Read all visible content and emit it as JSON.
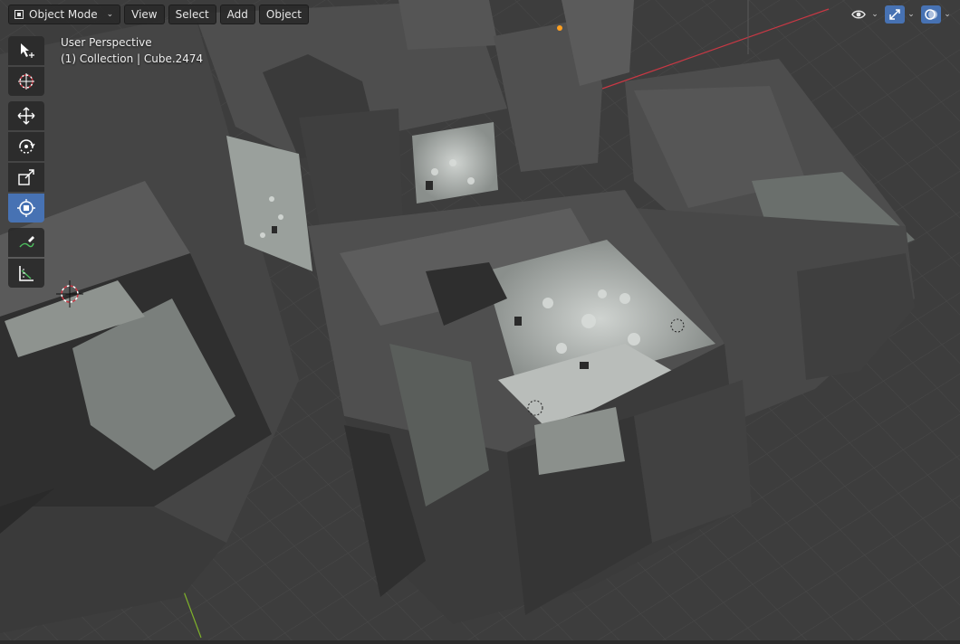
{
  "header": {
    "mode_label": "Object Mode",
    "menus": [
      "View",
      "Select",
      "Add",
      "Object"
    ],
    "right_icons": [
      "visibility-eye-icon",
      "gizmo-icon",
      "overlay-icon"
    ],
    "accent": "#4772b3"
  },
  "overlay": {
    "view_name": "User Perspective",
    "active_object": "(1) Collection | Cube.2474"
  },
  "toolbar": {
    "tools": [
      {
        "name": "select-box-tool",
        "icon": "cursor-arrow-icon",
        "active": false
      },
      {
        "name": "cursor-tool",
        "icon": "3d-cursor-icon",
        "active": false
      },
      {
        "name": "move-tool",
        "icon": "move-arrows-icon",
        "active": false
      },
      {
        "name": "rotate-tool",
        "icon": "rotate-icon",
        "active": false
      },
      {
        "name": "scale-tool",
        "icon": "scale-icon",
        "active": false
      },
      {
        "name": "transform-tool",
        "icon": "transform-icon",
        "active": true
      },
      {
        "name": "annotate-tool",
        "icon": "pencil-icon",
        "active": false
      },
      {
        "name": "measure-tool",
        "icon": "ruler-icon",
        "active": false
      }
    ]
  },
  "colors": {
    "viewport_bg": "#3d3d3d",
    "grid": "#4a4a4a",
    "x_axis": "#c93844",
    "y_axis": "#7fb22a"
  }
}
